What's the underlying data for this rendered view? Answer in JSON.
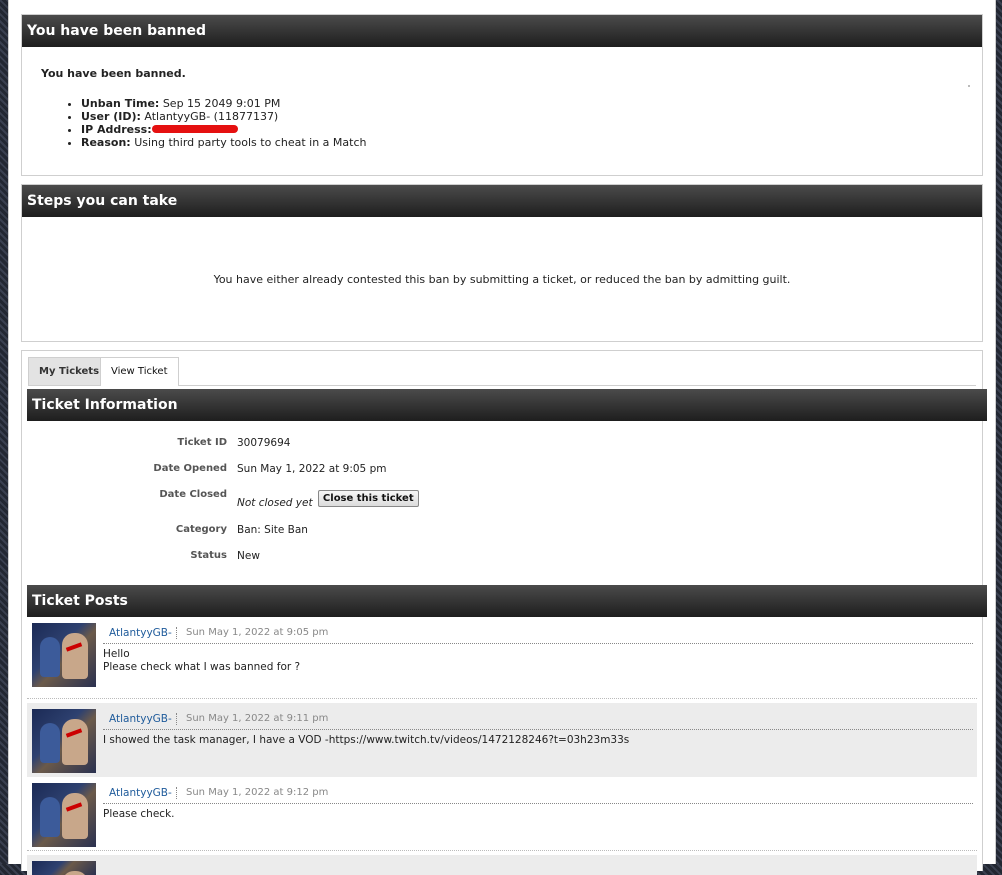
{
  "ban": {
    "title": "You have been banned",
    "heading": "You have been banned.",
    "items": [
      {
        "label": "Unban Time:",
        "value": "Sep 15 2049 9:01 PM"
      },
      {
        "label": "User (ID):",
        "value": "AtlantyyGB- (11877137)"
      },
      {
        "label": "IP Address:",
        "value": ""
      },
      {
        "label": "Reason:",
        "value": "Using third party tools to cheat in a Match"
      }
    ]
  },
  "steps": {
    "title": "Steps you can take",
    "text": "You have either already contested this ban by submitting a ticket, or reduced the ban by admitting guilt."
  },
  "tabs": [
    {
      "label": "My Tickets",
      "active": false
    },
    {
      "label": "View Ticket",
      "active": true
    }
  ],
  "ticket": {
    "title": "Ticket Information",
    "rows": [
      {
        "label": "Ticket ID",
        "value": "30079694"
      },
      {
        "label": "Date Opened",
        "value": "Sun May 1, 2022 at 9:05 pm"
      },
      {
        "label": "Date Closed",
        "value": "Not closed yet"
      },
      {
        "label": "Category",
        "value": "Ban: Site Ban"
      },
      {
        "label": "Status",
        "value": "New"
      }
    ],
    "close_button": "Close this ticket"
  },
  "posts": {
    "title": "Ticket Posts",
    "items": [
      {
        "user": "AtlantyyGB-",
        "date": "Sun May 1, 2022 at 9:05 pm",
        "lines": [
          "Hello",
          "Please check what I was banned for ?"
        ]
      },
      {
        "user": "AtlantyyGB-",
        "date": "Sun May 1, 2022 at 9:11 pm",
        "lines": [
          "I showed the task manager, I have a VOD -https://www.twitch.tv/videos/1472128246?t=03h23m33s"
        ]
      },
      {
        "user": "AtlantyyGB-",
        "date": "Sun May 1, 2022 at 9:12 pm",
        "lines": [
          "Please check."
        ]
      }
    ]
  },
  "colors": {
    "link": "#1f5b9b",
    "header_bar": "#2f2f2f",
    "redaction": "#e51010"
  }
}
